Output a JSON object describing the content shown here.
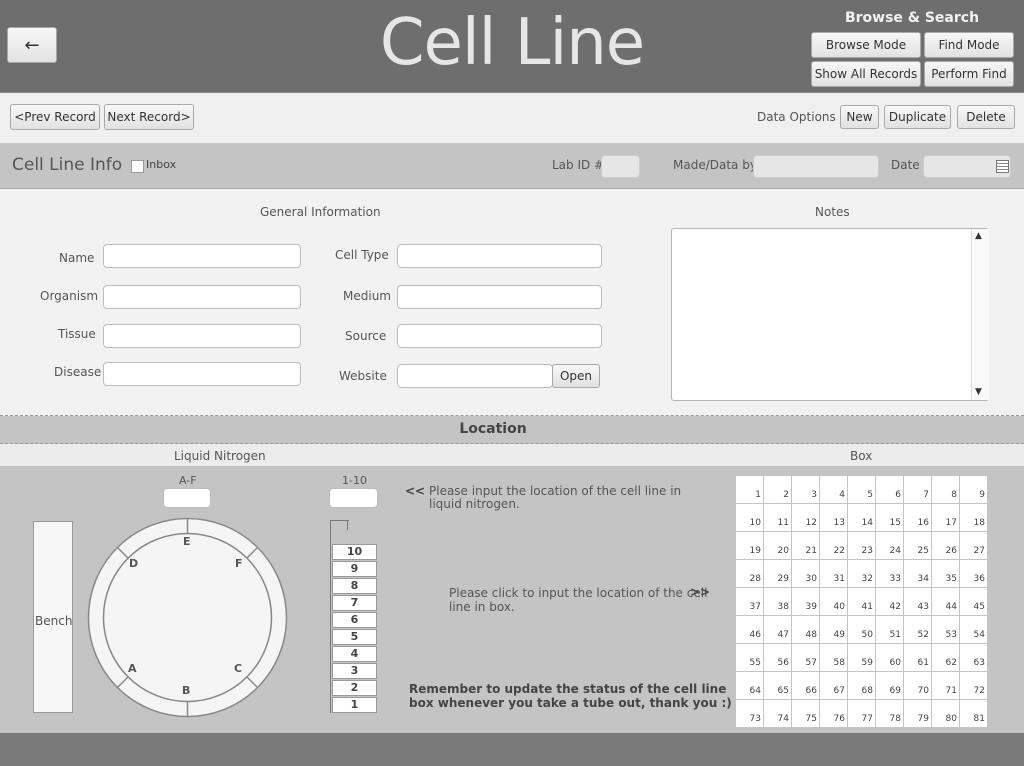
{
  "header": {
    "title": "Cell Line",
    "back_icon": "←",
    "browse_search_title": "Browse & Search",
    "browse_mode": "Browse Mode",
    "find_mode": "Find Mode",
    "show_all_records": "Show All Records",
    "perform_find": "Perform Find"
  },
  "toolbar": {
    "prev_record": "<Prev Record",
    "next_record": "Next Record>",
    "data_options_label": "Data Options",
    "new": "New",
    "duplicate": "Duplicate",
    "delete": "Delete"
  },
  "info": {
    "section_title": "Cell Line Info",
    "inbox_label": "Inbox",
    "lab_id_label": "Lab ID #",
    "lab_id_value": "",
    "made_by_label": "Made/Data by",
    "made_by_value": "",
    "date_label": "Date",
    "date_value": ""
  },
  "general": {
    "title": "General Information",
    "name_label": "Name",
    "organism_label": "Organism",
    "tissue_label": "Tissue",
    "disease_label": "Disease",
    "cell_type_label": "Cell Type",
    "medium_label": "Medium",
    "source_label": "Source",
    "website_label": "Website",
    "open_button": "Open",
    "values": {
      "name": "",
      "organism": "",
      "tissue": "",
      "disease": "",
      "cell_type": "",
      "medium": "",
      "source": "",
      "website": ""
    }
  },
  "notes": {
    "title": "Notes",
    "value": ""
  },
  "location": {
    "title": "Location",
    "liquid_nitrogen_label": "Liquid Nitrogen",
    "box_label": "Box",
    "af_label": "A-F",
    "one_ten_label": "1-10",
    "bench_label": "Bench",
    "dewar_sections": [
      "A",
      "B",
      "C",
      "D",
      "E",
      "F"
    ],
    "rack_slots": [
      "10",
      "9",
      "8",
      "7",
      "6",
      "5",
      "4",
      "3",
      "2",
      "1"
    ],
    "ln_instruction_arrow": "<<",
    "ln_instruction": "Please input the location of the cell line in",
    "ln_instruction_line2": "liquid nitrogen.",
    "box_instruction": "Please click to input the location of the cell",
    "box_instruction_arrow": ">>",
    "box_instruction_line2": "line in box.",
    "reminder": "Remember to update the status of the cell line",
    "reminder_line2": "box whenever you take a tube out, thank you :)",
    "box_positions_count": 81
  },
  "colors": {
    "header_bg": "#6e6e6e",
    "section_bg": "#c4c4c4",
    "panel_bg": "#f2f2f2",
    "footer_bg": "#7a7a7a"
  }
}
